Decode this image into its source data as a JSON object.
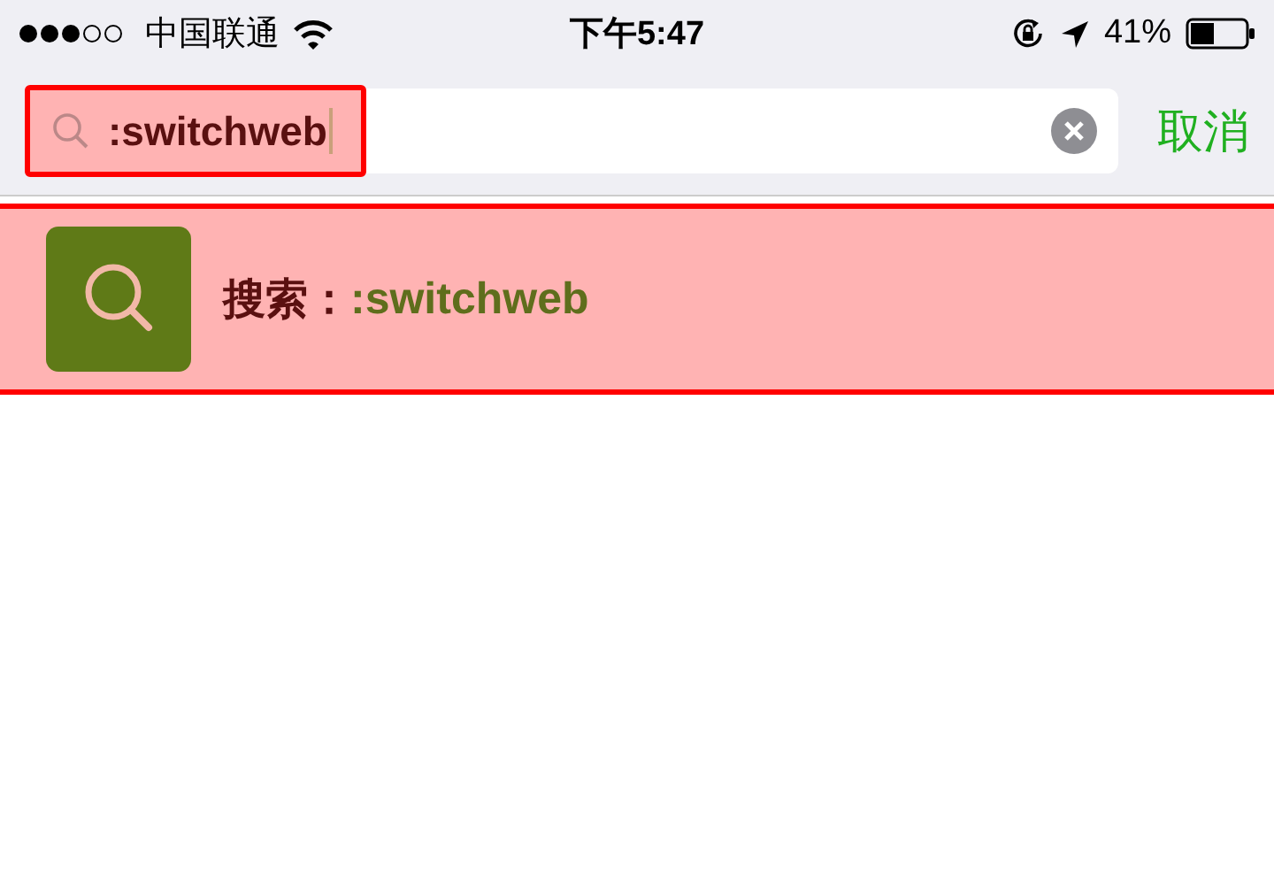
{
  "status_bar": {
    "carrier": "中国联通",
    "time": "下午5:47",
    "battery": "41%"
  },
  "search": {
    "value": ":switchweb",
    "cancel": "取消"
  },
  "result": {
    "prefix": "搜索：",
    "query": ":switchweb"
  }
}
